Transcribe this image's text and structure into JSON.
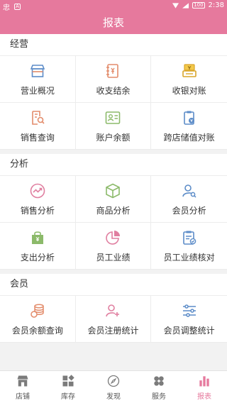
{
  "status": {
    "left_glyph": "忠",
    "carrier_chip": "A",
    "battery": "100",
    "time": "2:38"
  },
  "header": {
    "title": "报表"
  },
  "sections": [
    {
      "title": "经营",
      "items": [
        {
          "label": "营业概况",
          "icon": "store-icon"
        },
        {
          "label": "收支结余",
          "icon": "ledger-icon"
        },
        {
          "label": "收银对账",
          "icon": "cash-register-icon"
        },
        {
          "label": "销售查询",
          "icon": "sales-search-icon"
        },
        {
          "label": "账户余额",
          "icon": "account-card-icon"
        },
        {
          "label": "跨店储值对账",
          "icon": "stored-value-icon"
        }
      ]
    },
    {
      "title": "分析",
      "items": [
        {
          "label": "销售分析",
          "icon": "trend-icon"
        },
        {
          "label": "商品分析",
          "icon": "cube-icon"
        },
        {
          "label": "会员分析",
          "icon": "member-search-icon"
        },
        {
          "label": "支出分析",
          "icon": "expense-bag-icon"
        },
        {
          "label": "员工业绩",
          "icon": "pie-chart-icon"
        },
        {
          "label": "员工业绩核对",
          "icon": "clipboard-check-icon"
        }
      ]
    },
    {
      "title": "会员",
      "items": [
        {
          "label": "会员余额查询",
          "icon": "coin-stack-icon"
        },
        {
          "label": "会员注册统计",
          "icon": "add-user-icon"
        },
        {
          "label": "会员调整统计",
          "icon": "sliders-icon"
        }
      ]
    }
  ],
  "tabs": [
    {
      "label": "店铺",
      "icon": "shop-icon"
    },
    {
      "label": "库存",
      "icon": "inventory-icon"
    },
    {
      "label": "发现",
      "icon": "compass-icon"
    },
    {
      "label": "服务",
      "icon": "service-icon"
    },
    {
      "label": "报表",
      "icon": "report-bars-icon",
      "active": true
    }
  ],
  "colors": {
    "accent": "#e6799d",
    "blue": "#5c8cc8",
    "orange": "#e38c6b",
    "green": "#8cba6a",
    "pink": "#e07fa0",
    "gray": "#7b7b7b"
  }
}
